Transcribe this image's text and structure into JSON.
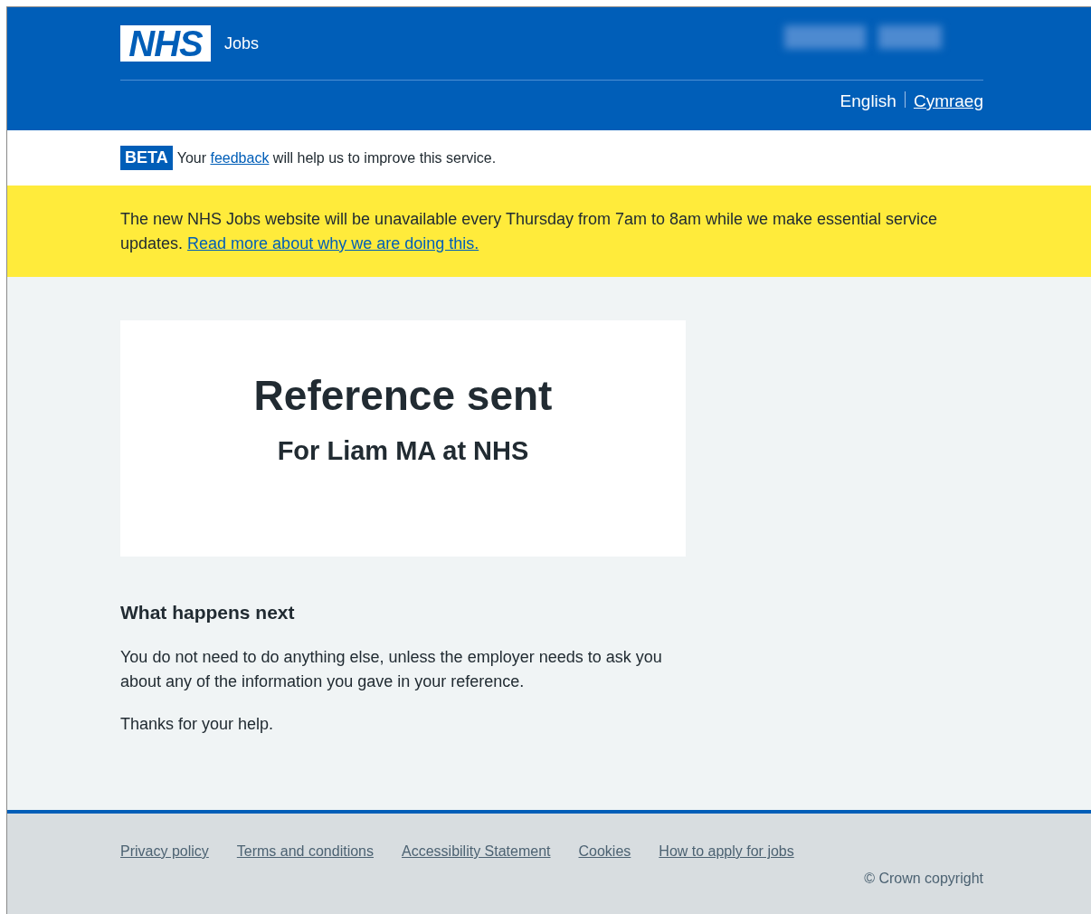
{
  "header": {
    "logo": "NHS",
    "service": "Jobs",
    "languages": [
      {
        "label": "English",
        "selected": true
      },
      {
        "label": "Cymraeg",
        "selected": false
      }
    ]
  },
  "phase_banner": {
    "tag": "BETA",
    "before": "Your",
    "link": "feedback",
    "after": "will help us to improve this service."
  },
  "notice": {
    "text": "The new NHS Jobs website will be unavailable every Thursday from 7am to 8am while we make essential service updates.",
    "link": "Read more about why we are doing this."
  },
  "panel": {
    "title": "Reference sent",
    "subtitle": "For Liam MA at NHS"
  },
  "next": {
    "heading": "What happens next",
    "paragraphs": [
      "You do not need to do anything else, unless the employer needs to ask you about any of the information you gave in your reference.",
      "Thanks for your help."
    ]
  },
  "footer": {
    "links": [
      "Privacy policy",
      "Terms and conditions",
      "Accessibility Statement",
      "Cookies",
      "How to apply for jobs"
    ],
    "copyright": "© Crown copyright"
  }
}
